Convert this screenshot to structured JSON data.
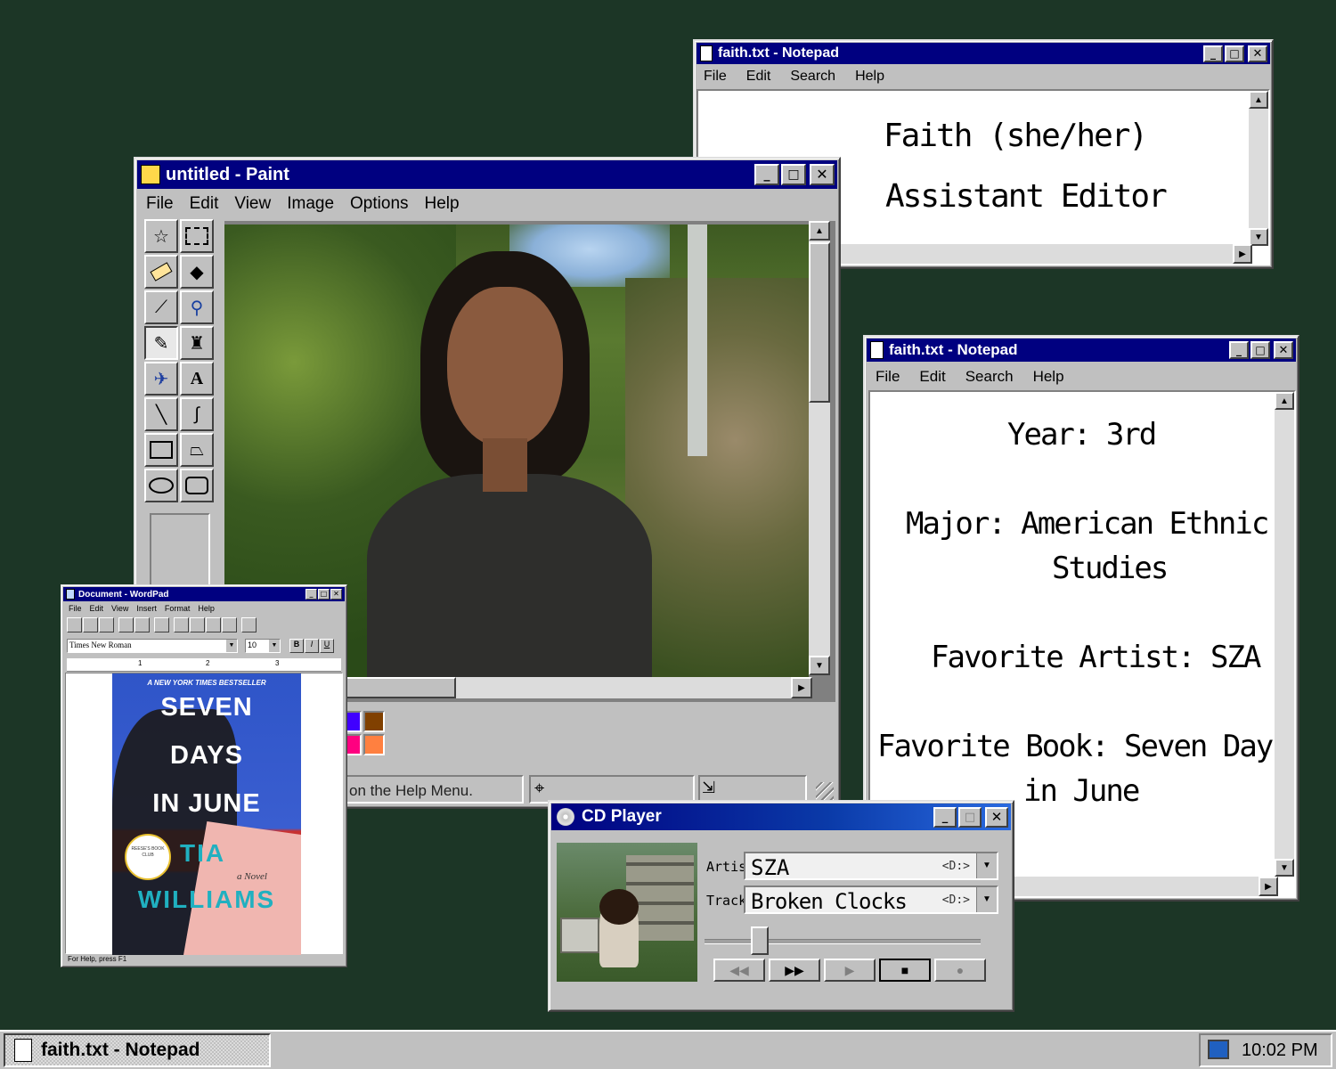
{
  "notepad1": {
    "title": "faith.txt - Notepad",
    "menu": [
      "File",
      "Edit",
      "Search",
      "Help"
    ],
    "lines": [
      "Faith (she/her)",
      "Assistant Editor"
    ]
  },
  "notepad2": {
    "title": "faith.txt - Notepad",
    "menu": [
      "File",
      "Edit",
      "Search",
      "Help"
    ],
    "lines": [
      "Year: 3rd",
      "Major: American Ethnic",
      "Studies",
      "Favorite Artist: SZA",
      "Favorite Book: Seven Days",
      "in June"
    ]
  },
  "paint": {
    "title": "untitled - Paint",
    "menu": [
      "File",
      "Edit",
      "View",
      "Image",
      "Options",
      "Help"
    ],
    "status": "on the Help Menu.",
    "palette_top": [
      "#800080",
      "#808040",
      "#004040",
      "#0080ff",
      "#004080",
      "#4000ff",
      "#804000"
    ],
    "palette_bottom": [
      "#ff00ff",
      "#ffff80",
      "#00ff80",
      "#80ffff",
      "#8080ff",
      "#ff0080",
      "#ff8040"
    ]
  },
  "wordpad": {
    "title": "Document - WordPad",
    "menu": [
      "File",
      "Edit",
      "View",
      "Insert",
      "Format",
      "Help"
    ],
    "font": "Times New Roman",
    "size": "10",
    "status": "For Help, press F1",
    "ruler": [
      "1",
      "2",
      "3"
    ],
    "book": {
      "tagline": "A NEW YORK TIMES BESTSELLER",
      "title_lines": [
        "SEVEN",
        "DAYS",
        "IN JUNE"
      ],
      "author_lines": [
        "TIA",
        "WILLIAMS"
      ],
      "subtitle": "a Novel",
      "badge": "REESE'S BOOK CLUB"
    }
  },
  "cdplayer": {
    "title": "CD Player",
    "artist_label": "Artist:",
    "artist": "SZA",
    "track_label": "Track:",
    "track": "Broken Clocks",
    "drive": "<D:>"
  },
  "taskbar": {
    "task": "faith.txt - Notepad",
    "clock": "10:02 PM"
  }
}
